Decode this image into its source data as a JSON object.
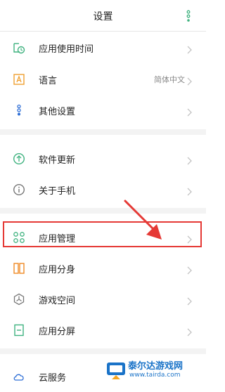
{
  "header": {
    "title": "设置"
  },
  "rows": [
    {
      "label": "应用使用时间",
      "icon": "clock-app-icon"
    },
    {
      "label": "语言",
      "value": "简体中文",
      "icon": "language-a-icon"
    },
    {
      "label": "其他设置",
      "icon": "dots-settings-icon"
    },
    {
      "label": "软件更新",
      "icon": "upload-arrow-icon"
    },
    {
      "label": "关于手机",
      "icon": "info-icon"
    },
    {
      "label": "应用管理",
      "icon": "grid-apps-icon"
    },
    {
      "label": "应用分身",
      "icon": "dual-app-icon"
    },
    {
      "label": "游戏空间",
      "icon": "game-space-icon"
    },
    {
      "label": "应用分屏",
      "icon": "split-screen-icon"
    },
    {
      "label": "云服务",
      "icon": "cloud-icon"
    }
  ],
  "watermark": {
    "brand": "泰尔达游戏网",
    "url": "www.tairda.com"
  },
  "colors": {
    "accent": "#3fb27f",
    "highlight": "#e53935",
    "watermark": "#1a73c8"
  }
}
